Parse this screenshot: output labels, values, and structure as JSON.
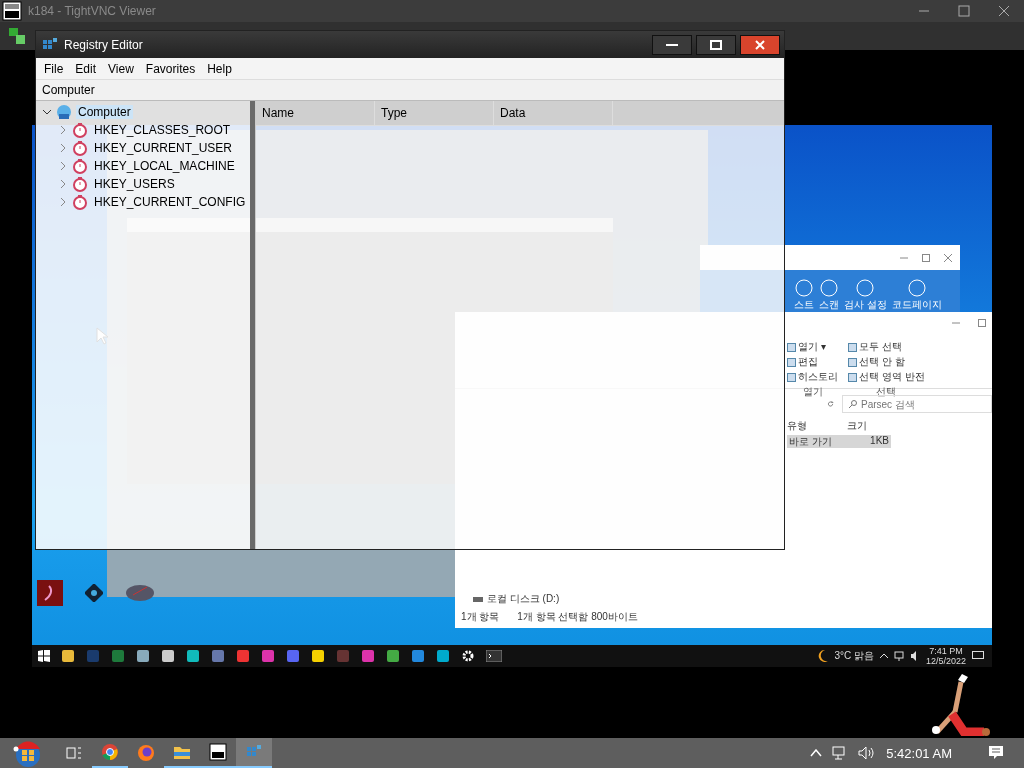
{
  "viewer": {
    "title": "k184 - TightVNC Viewer"
  },
  "registry_editor": {
    "title": "Registry Editor",
    "menu": [
      "File",
      "Edit",
      "View",
      "Favorites",
      "Help"
    ],
    "address": "Computer",
    "tree": [
      {
        "label": "Computer",
        "expanded": true,
        "selected": true,
        "children": [
          {
            "label": "HKEY_CLASSES_ROOT",
            "expanded": false,
            "selected": false
          },
          {
            "label": "HKEY_CURRENT_USER",
            "expanded": false,
            "selected": false
          },
          {
            "label": "HKEY_LOCAL_MACHINE",
            "expanded": false,
            "selected": false
          },
          {
            "label": "HKEY_USERS",
            "expanded": false,
            "selected": false
          },
          {
            "label": "HKEY_CURRENT_CONFIG",
            "expanded": false,
            "selected": false
          }
        ]
      }
    ],
    "columns": [
      "Name",
      "Type",
      "Data"
    ]
  },
  "remote": {
    "blue_app": {
      "tools": [
        "스트",
        "스캔",
        "검사 설정",
        "코드페이지"
      ]
    },
    "explorer": {
      "groups": [
        {
          "label": "열기",
          "items": [
            "열기 ▾",
            "편집",
            "히스토리"
          ]
        },
        {
          "label": "선택",
          "items": [
            "모두 선택",
            "선택 안 함",
            "선택 영역 반전"
          ]
        }
      ],
      "search": {
        "placeholder": "Parsec 검색"
      },
      "columns": [
        "유형",
        "크기"
      ],
      "rows": [
        {
          "cells": [
            "바로 가기",
            "1KB"
          ],
          "selected": true
        }
      ],
      "nav_item": "로컬 디스크 (D:)",
      "status": [
        "1개 항목",
        "1개 항목 선택함 800바이트"
      ]
    },
    "taskbar": {
      "weather": "3°C 맑음",
      "time": "7:41 PM",
      "date": "12/5/2022"
    }
  },
  "host_taskbar": {
    "clock": "5:42:01 AM"
  }
}
